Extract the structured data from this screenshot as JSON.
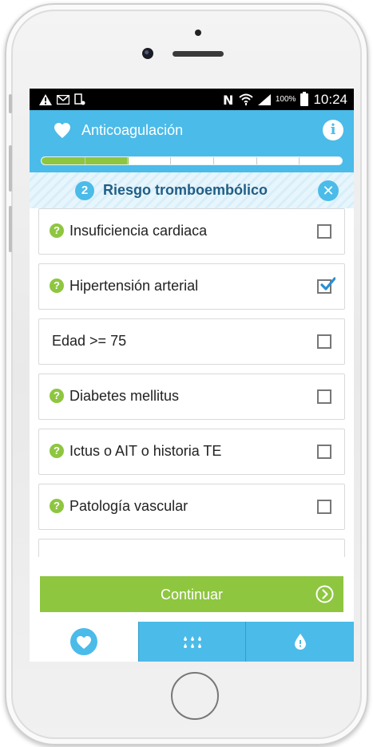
{
  "status_bar": {
    "time": "10:24",
    "battery_percent": "100%",
    "left_icons": [
      "warning-icon",
      "mail-icon",
      "screenshot-icon"
    ],
    "right_icons": [
      "nfc-icon",
      "wifi-icon",
      "signal-icon",
      "battery-icon"
    ]
  },
  "app_bar": {
    "title": "Anticoagulación",
    "icon": "heart-icon",
    "info_icon": "info-icon"
  },
  "progress": {
    "segments": 7,
    "completed_fraction": 0.29
  },
  "step": {
    "number": "2",
    "title": "Riesgo tromboembólico",
    "close_icon": "close-icon"
  },
  "criteria": [
    {
      "label": "Insuficiencia cardiaca",
      "help": true,
      "checked": false
    },
    {
      "label": "Hipertensión arterial",
      "help": true,
      "checked": true
    },
    {
      "label": "Edad >= 75",
      "help": false,
      "checked": false
    },
    {
      "label": "Diabetes mellitus",
      "help": true,
      "checked": false
    },
    {
      "label": "Ictus o AIT o historia TE",
      "help": true,
      "checked": false
    },
    {
      "label": "Patología vascular",
      "help": true,
      "checked": false
    }
  ],
  "continue_button": {
    "label": "Continuar",
    "icon": "arrow-right-circle-icon"
  },
  "tabs": [
    {
      "icon": "heart-icon",
      "active": true
    },
    {
      "icon": "drops-icon",
      "active": false
    },
    {
      "icon": "drop-icon",
      "active": false
    }
  ],
  "colors": {
    "primary": "#4bbbe9",
    "accent": "#8ec640",
    "title_text": "#215e86"
  }
}
